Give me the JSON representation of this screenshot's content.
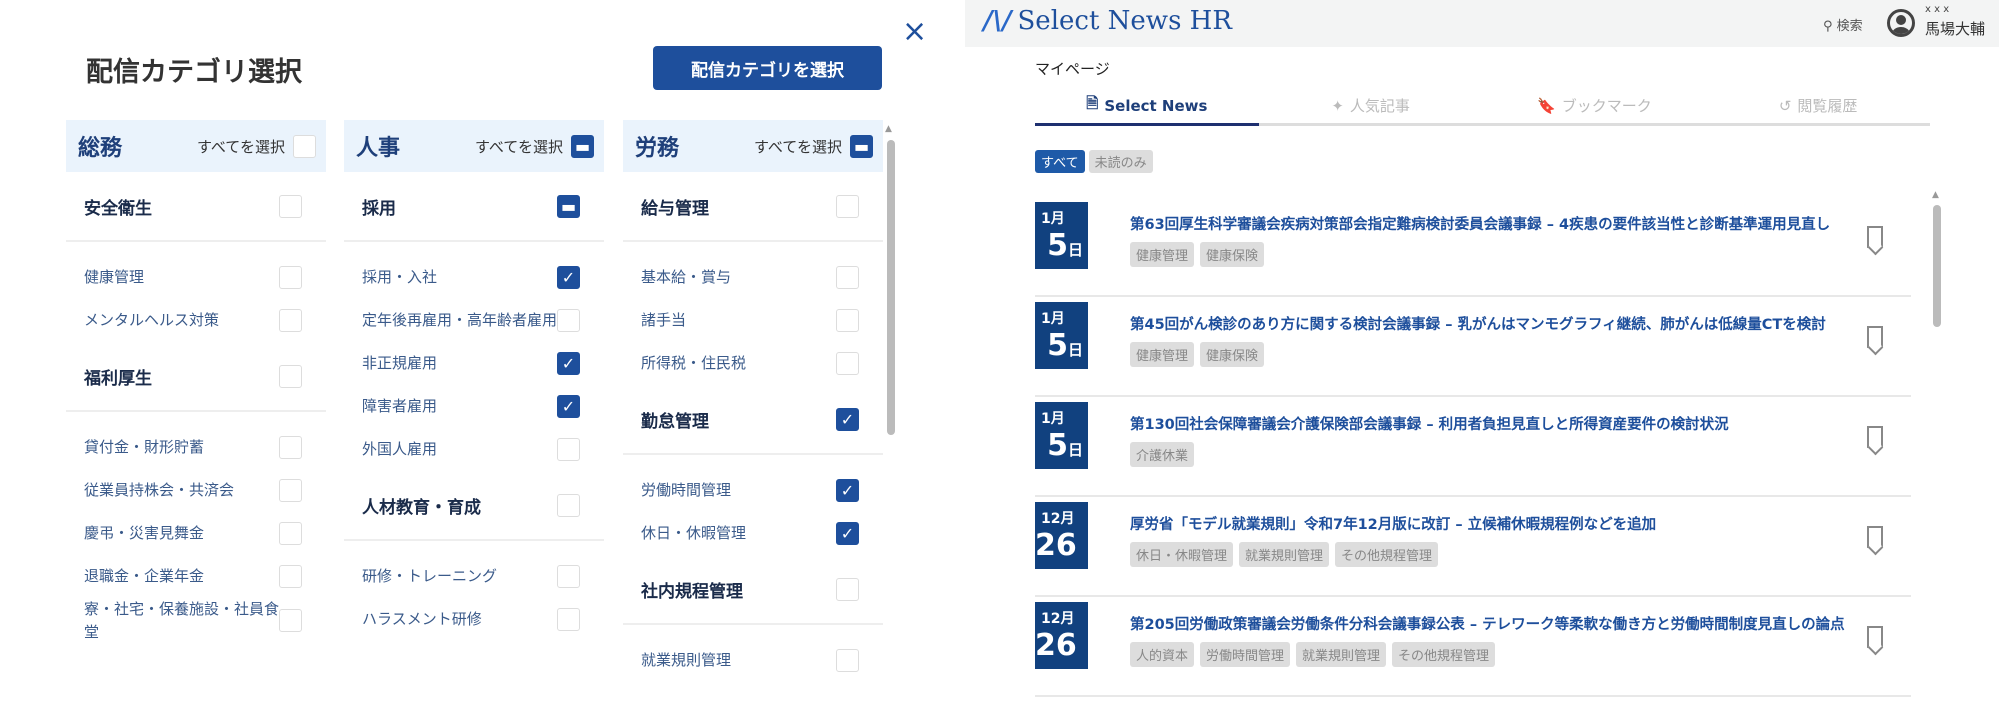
{
  "modal": {
    "title": "配信カテゴリ選択",
    "select_button": "配信カテゴリを選択",
    "close": "×",
    "columns": [
      {
        "name": "総務",
        "select_all": "すべてを選択",
        "state": "off",
        "groups": [
          {
            "label": "安全衛生",
            "state": "off",
            "items": [
              {
                "label": "健康管理",
                "checked": false
              },
              {
                "label": "メンタルヘルス対策",
                "checked": false
              }
            ]
          },
          {
            "label": "福利厚生",
            "state": "off",
            "items": [
              {
                "label": "貸付金・財形貯蓄",
                "checked": false
              },
              {
                "label": "従業員持株会・共済会",
                "checked": false
              },
              {
                "label": "慶弔・災害見舞金",
                "checked": false
              },
              {
                "label": "退職金・企業年金",
                "checked": false
              },
              {
                "label": "寮・社宅・保養施設・社員食堂",
                "checked": false
              }
            ]
          }
        ]
      },
      {
        "name": "人事",
        "select_all": "すべてを選択",
        "state": "partial",
        "groups": [
          {
            "label": "採用",
            "state": "partial",
            "items": [
              {
                "label": "採用・入社",
                "checked": true
              },
              {
                "label": "定年後再雇用・高年齢者雇用",
                "checked": false
              },
              {
                "label": "非正規雇用",
                "checked": true
              },
              {
                "label": "障害者雇用",
                "checked": true
              },
              {
                "label": "外国人雇用",
                "checked": false
              }
            ]
          },
          {
            "label": "人材教育・育成",
            "state": "off",
            "items": [
              {
                "label": "研修・トレーニング",
                "checked": false
              },
              {
                "label": "ハラスメント研修",
                "checked": false
              }
            ]
          }
        ]
      },
      {
        "name": "労務",
        "select_all": "すべてを選択",
        "state": "partial",
        "groups": [
          {
            "label": "給与管理",
            "state": "off",
            "items": [
              {
                "label": "基本給・賞与",
                "checked": false
              },
              {
                "label": "諸手当",
                "checked": false
              },
              {
                "label": "所得税・住民税",
                "checked": false
              }
            ]
          },
          {
            "label": "勤怠管理",
            "state": "on",
            "items": [
              {
                "label": "労働時間管理",
                "checked": true
              },
              {
                "label": "休日・休暇管理",
                "checked": true
              }
            ]
          },
          {
            "label": "社内規程管理",
            "state": "off",
            "items": [
              {
                "label": "就業規則管理",
                "checked": false
              }
            ]
          }
        ]
      }
    ]
  },
  "app": {
    "logo": "Select News HR",
    "search": "検索",
    "user_id": "x x x",
    "user_name": "馬場大輔",
    "page_title": "マイページ",
    "tabs": [
      "Select News",
      "人気記事",
      "ブックマーク",
      "閲覧履歴"
    ],
    "filters": [
      "すべて",
      "未読のみ"
    ],
    "articles": [
      {
        "month": "1月",
        "day": "5",
        "day_suffix": "日",
        "title": "第63回厚生科学審議会疾病対策部会指定難病検討委員会議事録 – 4疾患の要件該当性と診断基準運用見直し",
        "tags": [
          "健康管理",
          "健康保険"
        ]
      },
      {
        "month": "1月",
        "day": "5",
        "day_suffix": "日",
        "title": "第45回がん検診のあり方に関する検討会議事録 – 乳がんはマンモグラフィ継続、肺がんは低線量CTを検討",
        "tags": [
          "健康管理",
          "健康保険"
        ]
      },
      {
        "month": "1月",
        "day": "5",
        "day_suffix": "日",
        "title": "第130回社会保障審議会介護保険部会議事録 – 利用者負担見直しと所得資産要件の検討状況",
        "tags": [
          "介護休業"
        ]
      },
      {
        "month": "12月",
        "day": "26",
        "day_suffix": "日",
        "title": "厚労省「モデル就業規則」令和7年12月版に改訂 – 立候補休暇規程例などを追加",
        "tags": [
          "休日・休暇管理",
          "就業規則管理",
          "その他規程管理"
        ]
      },
      {
        "month": "12月",
        "day": "26",
        "day_suffix": "日",
        "title": "第205回労働政策審議会労働条件分科会議事録公表 – テレワーク等柔軟な働き方と労働時間制度見直しの論点",
        "tags": [
          "人的資本",
          "労働時間管理",
          "就業規則管理",
          "その他規程管理"
        ]
      }
    ]
  }
}
